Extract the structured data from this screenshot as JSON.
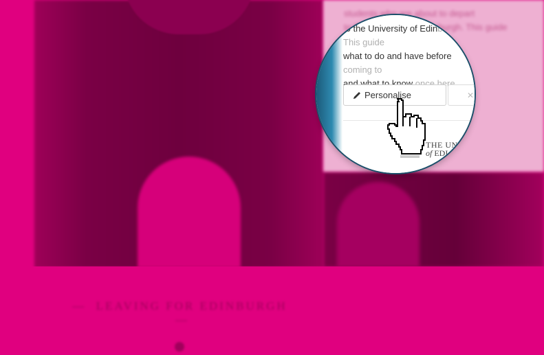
{
  "background": {
    "accent": "#e0007f",
    "heading": "LEAVING FOR EDINBURGH",
    "heading_dashes": "—"
  },
  "panel": {
    "blurred_line1": "students who are about to depart",
    "blurred_line2": "to the University of Edinburgh. This guide"
  },
  "magnifier": {
    "text_line1_prefix": "to the University of Edin",
    "text_line1_faded": "burgh. This guide",
    "text_line2_prefix": "what to do and have before",
    "text_line2_faded": " coming to",
    "text_line3_prefix": "and what to know ",
    "text_line3_faded": "once here.",
    "personalise_label": "Personalise",
    "pencil_icon": "pencil-icon",
    "second_button_icon": "✕",
    "logo_line1": "THE UN",
    "logo_line2_prefix": "of",
    "logo_line2": " EDI"
  },
  "cursor": "hand-pointer-icon"
}
